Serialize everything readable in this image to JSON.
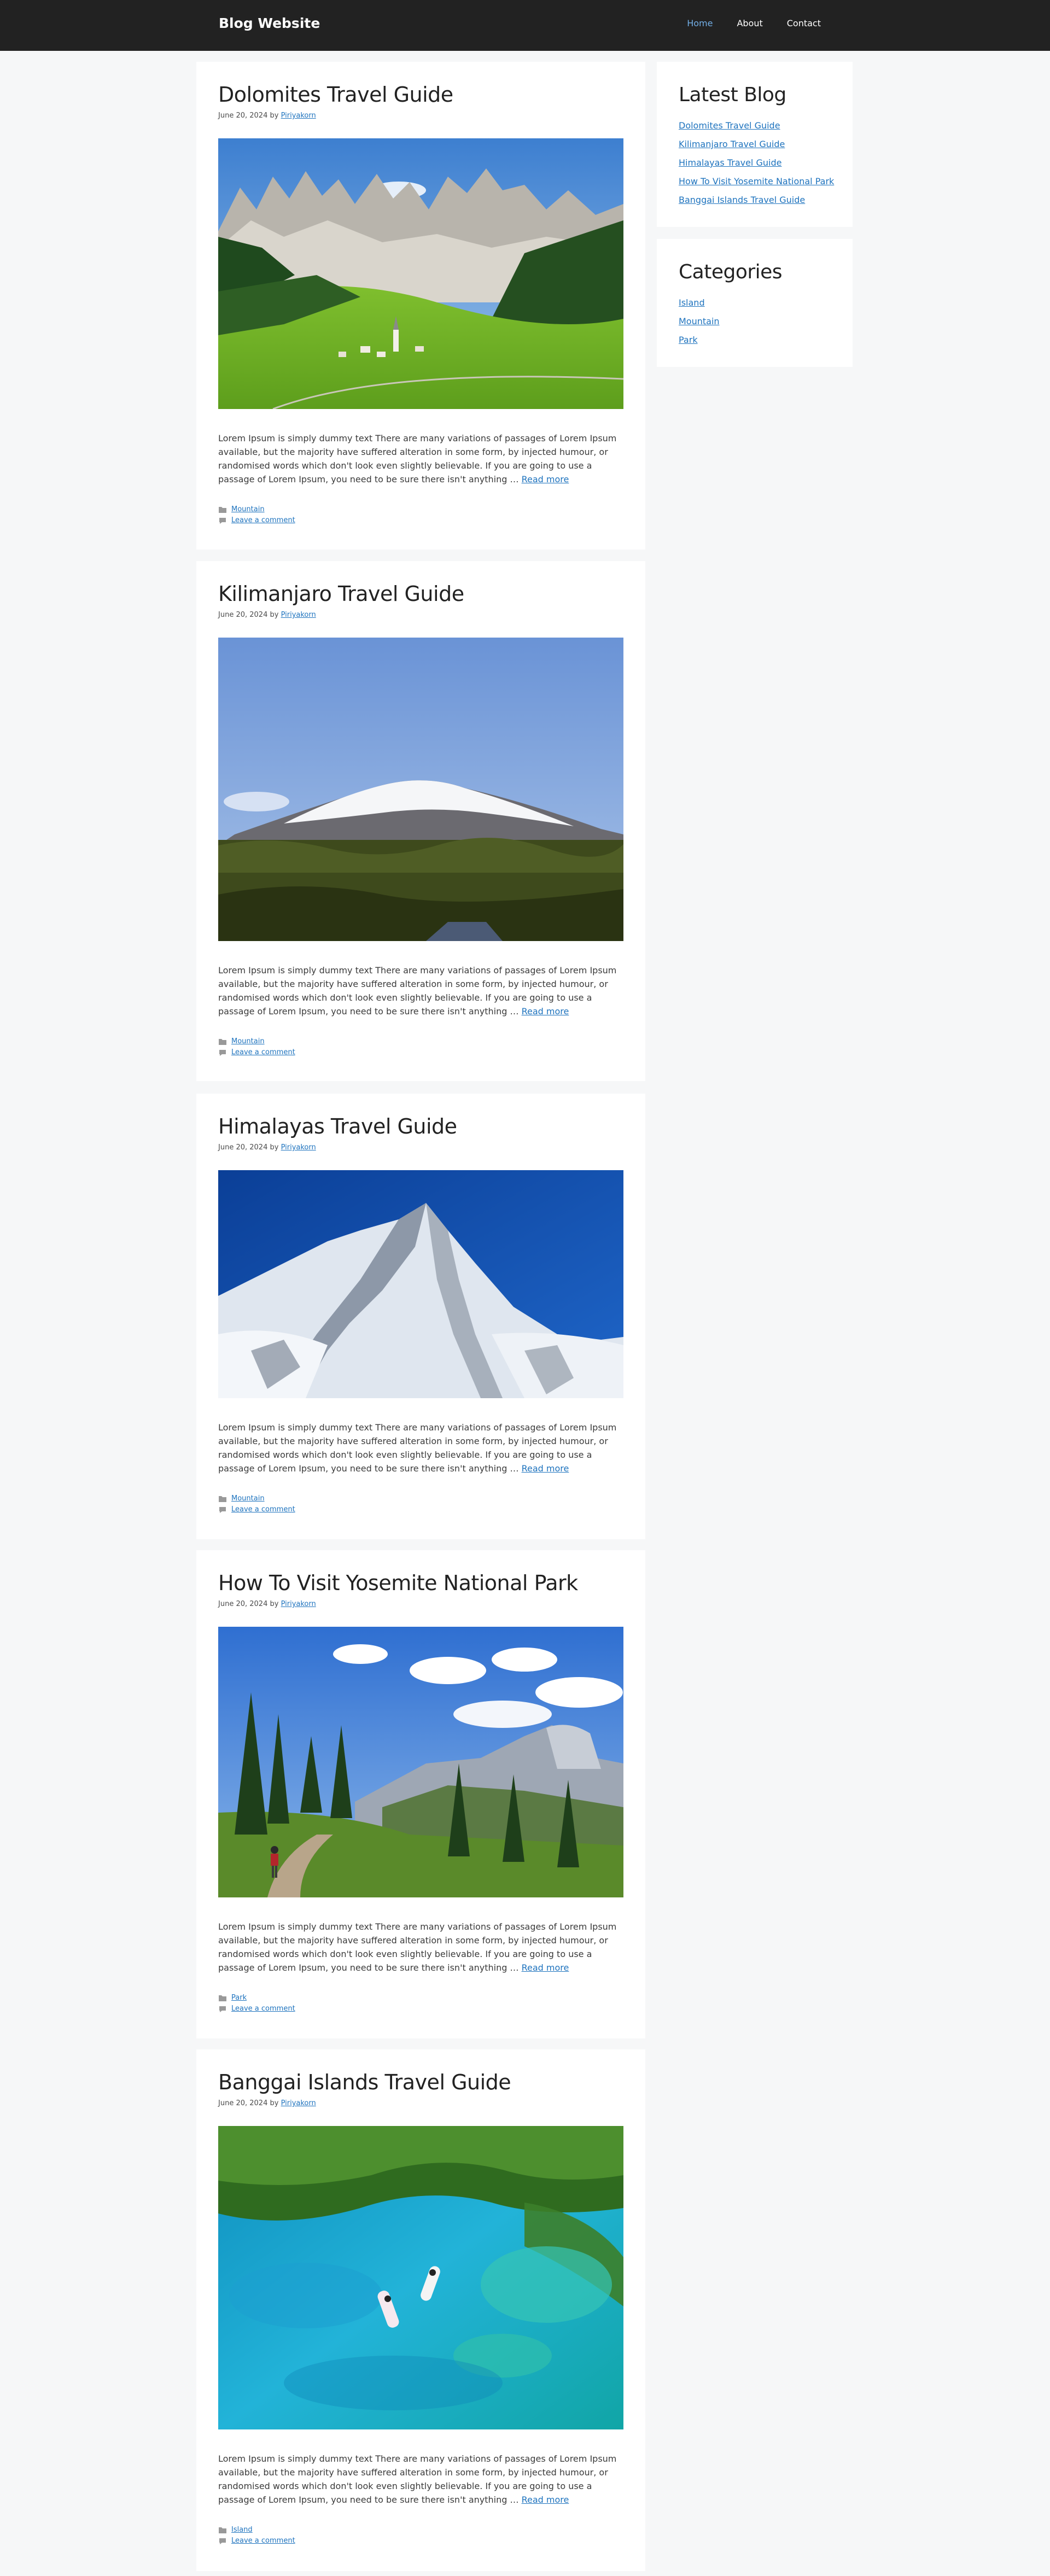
{
  "header": {
    "brand": "Blog Website",
    "nav": [
      {
        "label": "Home",
        "active": true
      },
      {
        "label": "About",
        "active": false
      },
      {
        "label": "Contact",
        "active": false
      }
    ]
  },
  "posts": [
    {
      "title": "Dolomites Travel Guide",
      "date": "June 20, 2024",
      "by": "by",
      "author": "Piriyakorn",
      "excerpt": "Lorem Ipsum is simply dummy text There are many variations of passages of Lorem Ipsum available, but the majority have suffered alteration in some form, by injected humour, or randomised words which don't look even slightly believable. If you are going to use a passage of Lorem Ipsum, you need to be sure there isn't anything …",
      "read_more": "Read more",
      "category": "Mountain",
      "comment": "Leave a comment",
      "image": "dolomites-mountain-village-photo"
    },
    {
      "title": "Kilimanjaro Travel Guide",
      "date": "June 20, 2024",
      "by": "by",
      "author": "Piriyakorn",
      "excerpt": "Lorem Ipsum is simply dummy text There are many variations of passages of Lorem Ipsum available, but the majority have suffered alteration in some form, by injected humour, or randomised words which don't look even slightly believable. If you are going to use a passage of Lorem Ipsum, you need to be sure there isn't anything …",
      "read_more": "Read more",
      "category": "Mountain",
      "comment": "Leave a comment",
      "image": "kilimanjaro-snow-peak-photo"
    },
    {
      "title": "Himalayas Travel Guide",
      "date": "June 20, 2024",
      "by": "by",
      "author": "Piriyakorn",
      "excerpt": "Lorem Ipsum is simply dummy text There are many variations of passages of Lorem Ipsum available, but the majority have suffered alteration in some form, by injected humour, or randomised words which don't look even slightly believable. If you are going to use a passage of Lorem Ipsum, you need to be sure there isn't anything …",
      "read_more": "Read more",
      "category": "Mountain",
      "comment": "Leave a comment",
      "image": "himalayas-snow-peak-photo"
    },
    {
      "title": "How To Visit Yosemite National Park",
      "date": "June 20, 2024",
      "by": "by",
      "author": "Piriyakorn",
      "excerpt": "Lorem Ipsum is simply dummy text There are many variations of passages of Lorem Ipsum available, but the majority have suffered alteration in some form, by injected humour, or randomised words which don't look even slightly believable. If you are going to use a passage of Lorem Ipsum, you need to be sure there isn't anything …",
      "read_more": "Read more",
      "category": "Park",
      "comment": "Leave a comment",
      "image": "yosemite-hiker-valley-photo"
    },
    {
      "title": "Banggai Islands Travel Guide",
      "date": "June 20, 2024",
      "by": "by",
      "author": "Piriyakorn",
      "excerpt": "Lorem Ipsum is simply dummy text There are many variations of passages of Lorem Ipsum available, but the majority have suffered alteration in some form, by injected humour, or randomised words which don't look even slightly believable. If you are going to use a passage of Lorem Ipsum, you need to be sure there isn't anything …",
      "read_more": "Read more",
      "category": "Island",
      "comment": "Leave a comment",
      "image": "banggai-turquoise-lagoon-photo"
    }
  ],
  "sidebar": {
    "latest": {
      "title": "Latest Blog",
      "items": [
        "Dolomites Travel Guide",
        "Kilimanjaro Travel Guide",
        "Himalayas Travel Guide",
        "How To Visit Yosemite National Park",
        "Banggai Islands Travel Guide"
      ]
    },
    "categories": {
      "title": "Categories",
      "items": [
        "Island",
        "Mountain",
        "Park"
      ]
    }
  },
  "colors": {
    "header_bg": "#222222",
    "page_bg": "#f6f7f8",
    "link": "#1e73be",
    "nav_active": "#72aee6"
  }
}
